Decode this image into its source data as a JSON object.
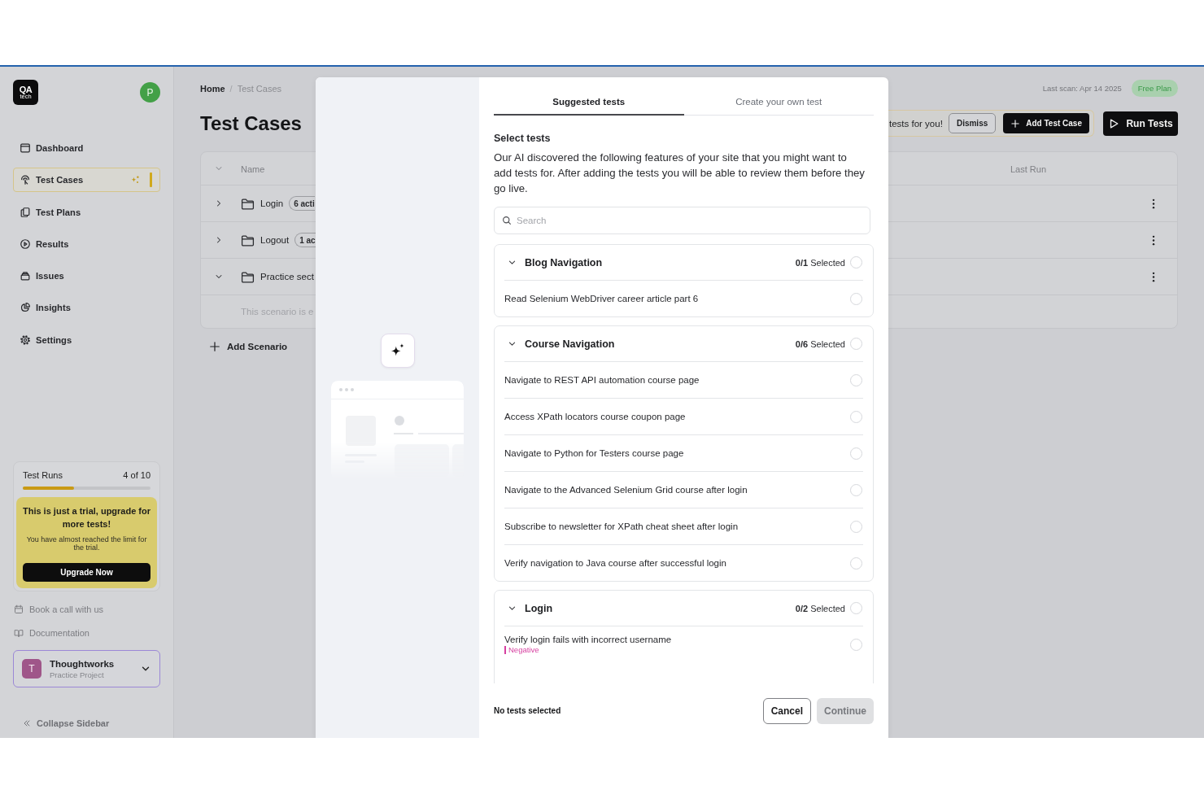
{
  "sidebar": {
    "logo": {
      "mark": "QA",
      "subtitle": "tech"
    },
    "avatar": "P",
    "nav": [
      {
        "label": "Dashboard",
        "selected": false
      },
      {
        "label": "Test Cases",
        "selected": true
      },
      {
        "label": "Test Plans",
        "selected": false
      },
      {
        "label": "Results",
        "selected": false
      },
      {
        "label": "Issues",
        "selected": false
      },
      {
        "label": "Insights",
        "selected": false
      },
      {
        "label": "Settings",
        "selected": false
      }
    ],
    "usage": {
      "title": "Test Runs",
      "count": "4 of 10",
      "level": 0.4
    },
    "trial": {
      "title": "This is just a trial, upgrade for more tests!",
      "text": "You have almost reached the limit for the trial.",
      "button": "Upgrade Now"
    },
    "links": [
      "Book a call with us",
      "Documentation"
    ],
    "project": {
      "initial": "T",
      "name": "Thoughtworks",
      "subtitle": "Practice Project"
    },
    "collapse": "Collapse Sidebar"
  },
  "main": {
    "breadcrumb": {
      "items": [
        "Home",
        "Test Cases"
      ],
      "separator": "/"
    },
    "last_scan": "Last scan: Apr 14 2025",
    "plan": "Free Plan",
    "title": "Test Cases",
    "banner": {
      "text": "tests for you!",
      "dismiss": "Dismiss",
      "add": "Add Test Case"
    },
    "run_button": "Run Tests",
    "table": {
      "columns": [
        "Name",
        "Last Run"
      ],
      "rows": [
        {
          "name": "Login",
          "badge": "6 acti",
          "expanded": false
        },
        {
          "name": "Logout",
          "badge": "1 ac",
          "expanded": false
        },
        {
          "name": "Practice sect",
          "expanded": true,
          "note": "This scenario is e"
        }
      ]
    },
    "add_scenario": "Add Scenario"
  },
  "modal": {
    "tabs": [
      {
        "label": "Suggested tests",
        "selected": true
      },
      {
        "label": "Create your own test",
        "selected": false
      }
    ],
    "heading": "Select tests",
    "description": "Our AI discovered the following features of your site that you might want to add tests for. After adding the tests you will be able to review them before they go live.",
    "search": {
      "placeholder": "Search"
    },
    "groups": [
      {
        "title": "Blog Navigation",
        "count": "**0/1** Selected",
        "expanded": true,
        "checked": false,
        "tests": [
          {
            "name": "Read Selenium WebDriver career article part 6",
            "checked": false
          }
        ]
      },
      {
        "title": "Course Navigation",
        "count": "**0/6** Selected",
        "expanded": true,
        "checked": false,
        "tests": [
          {
            "name": "Navigate to REST API automation course page",
            "checked": false
          },
          {
            "name": "Access XPath locators course coupon page",
            "checked": false
          },
          {
            "name": "Navigate to Python for Testers course page",
            "checked": false
          },
          {
            "name": "Navigate to the Advanced Selenium Grid course after login",
            "checked": false
          },
          {
            "name": "Subscribe to newsletter for XPath cheat sheet after login",
            "checked": false
          },
          {
            "name": "Verify navigation to Java course after successful login",
            "checked": false
          }
        ]
      },
      {
        "title": "Login",
        "count": "**0/2** Selected",
        "expanded": true,
        "checked": false,
        "tests": [
          {
            "name": "Verify login fails with incorrect username",
            "tag": "Negative",
            "checked": false
          }
        ]
      }
    ],
    "footer": {
      "status": "No tests selected",
      "cancel": "Cancel",
      "continue_button": {
        "label": "Continue",
        "disabled": true
      }
    }
  }
}
